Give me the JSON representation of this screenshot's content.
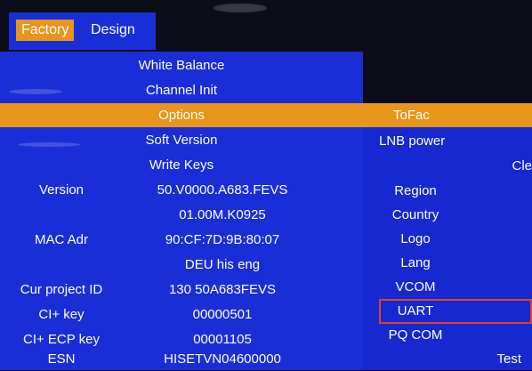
{
  "tabs": [
    {
      "label": "Factory",
      "active": true
    },
    {
      "label": "Design",
      "active": false
    }
  ],
  "main_menu": [
    {
      "label": "White Balance"
    },
    {
      "label": "Channel Init"
    },
    {
      "label": "Options",
      "selected": true
    },
    {
      "label": "Soft Version"
    },
    {
      "label": "Write Keys"
    }
  ],
  "info_rows": [
    {
      "label": "Version",
      "value": "50.V0000.A683.FEVS"
    },
    {
      "label": "",
      "value": "01.00M.K0925"
    },
    {
      "label": "MAC Adr",
      "value": "90:CF:7D:9B:80:07"
    },
    {
      "label": "",
      "value": "DEU his eng"
    },
    {
      "label": "Cur project ID",
      "value": "130 50A683FEVS"
    },
    {
      "label": "CI+ key",
      "value": "00000501"
    },
    {
      "label": "CI+ ECP key",
      "value": "00001105"
    },
    {
      "label": "ESN",
      "value": "HISETVN04600000"
    }
  ],
  "options_menu": {
    "tofac": "ToFac",
    "lnb_power": "LNB power",
    "cle_partial": "Cle",
    "region": "Region",
    "country": "Country",
    "logo": "Logo",
    "lang": "Lang",
    "vcom": "VCOM",
    "uart": "UART",
    "pq_com": "PQ COM",
    "test": "Test"
  },
  "colors": {
    "panel_blue": "#1a2ed8",
    "highlight_orange": "#e8951c",
    "focus_outline_red": "#e0402a"
  }
}
